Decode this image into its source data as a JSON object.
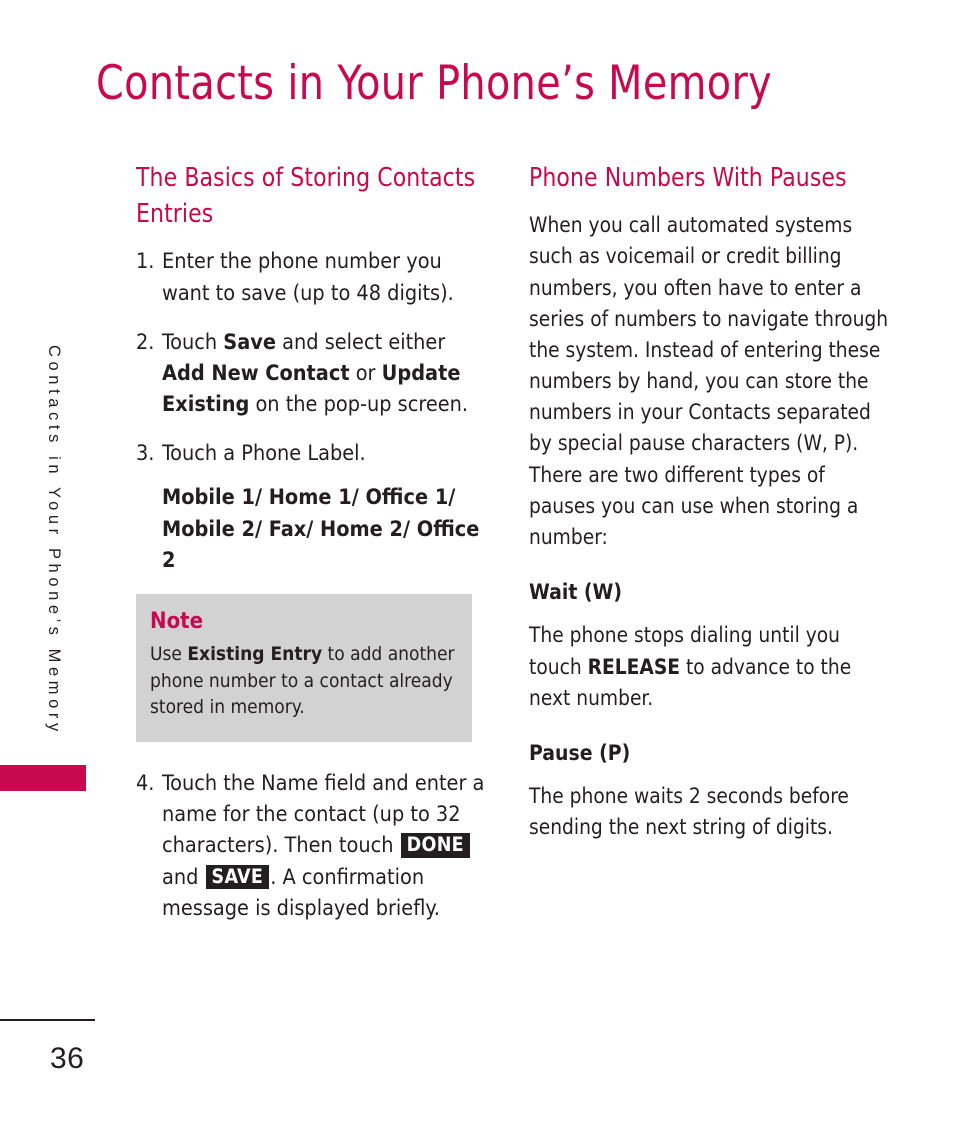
{
  "page": {
    "title": "Contacts in Your Phone’s Memory",
    "running_head": "Contacts in Your Phone’s Memory",
    "number": "36",
    "accent_color": "#c8084f",
    "text_color": "#231f20",
    "note_background": "#d2d2d2"
  },
  "left_column": {
    "heading": "The Basics of Storing Contacts Entries",
    "steps": [
      {
        "number": "1.",
        "text_parts": [
          {
            "type": "plain",
            "text": "Enter the phone number you want to save (up to 48 digits)."
          }
        ]
      },
      {
        "number": "2.",
        "text_parts": [
          {
            "type": "plain",
            "text": "Touch "
          },
          {
            "type": "bold",
            "text": "Save"
          },
          {
            "type": "plain",
            "text": " and select either "
          },
          {
            "type": "bold",
            "text": "Add New Contact"
          },
          {
            "type": "plain",
            "text": " or "
          },
          {
            "type": "bold",
            "text": "Update Existing"
          },
          {
            "type": "plain",
            "text": " on the pop-up screen."
          }
        ]
      },
      {
        "number": "3.",
        "text_parts": [
          {
            "type": "plain",
            "text": "Touch a Phone Label."
          }
        ],
        "sub_text": "Mobile 1/ Home 1/ Office 1/ Mobile 2/ Fax/ Home 2/ Office 2"
      },
      {
        "number": "4.",
        "text_parts": [
          {
            "type": "plain",
            "text": "Touch the Name field and enter a name for the contact (up to 32 characters). Then touch "
          },
          {
            "type": "keycap",
            "text": "DONE"
          },
          {
            "type": "plain",
            "text": " and "
          },
          {
            "type": "keycap",
            "text": "SAVE"
          },
          {
            "type": "plain",
            "text": ". A confirmation message is displayed briefly."
          }
        ]
      }
    ],
    "note": {
      "title": "Note",
      "text_parts": [
        {
          "type": "plain",
          "text": "Use "
        },
        {
          "type": "bold",
          "text": "Existing Entry"
        },
        {
          "type": "plain",
          "text": " to add another phone number to a contact already stored in memory."
        }
      ]
    }
  },
  "right_column": {
    "heading": "Phone Numbers With Pauses",
    "intro": "When you call automated systems such as voicemail or credit billing numbers, you often have to enter a series of numbers to navigate through the system. Instead of entering these numbers by hand, you can store the numbers in your Contacts separated by special pause characters (W, P). There are two different types of pauses you can use when storing a number:",
    "subsections": [
      {
        "heading": "Wait (W)",
        "text_parts": [
          {
            "type": "plain",
            "text": "The phone stops dialing until you touch "
          },
          {
            "type": "bold",
            "text": "RELEASE"
          },
          {
            "type": "plain",
            "text": " to advance to the next number."
          }
        ]
      },
      {
        "heading": "Pause (P)",
        "text_parts": [
          {
            "type": "plain",
            "text": "The phone waits 2 seconds before sending the next string of digits."
          }
        ]
      }
    ]
  }
}
